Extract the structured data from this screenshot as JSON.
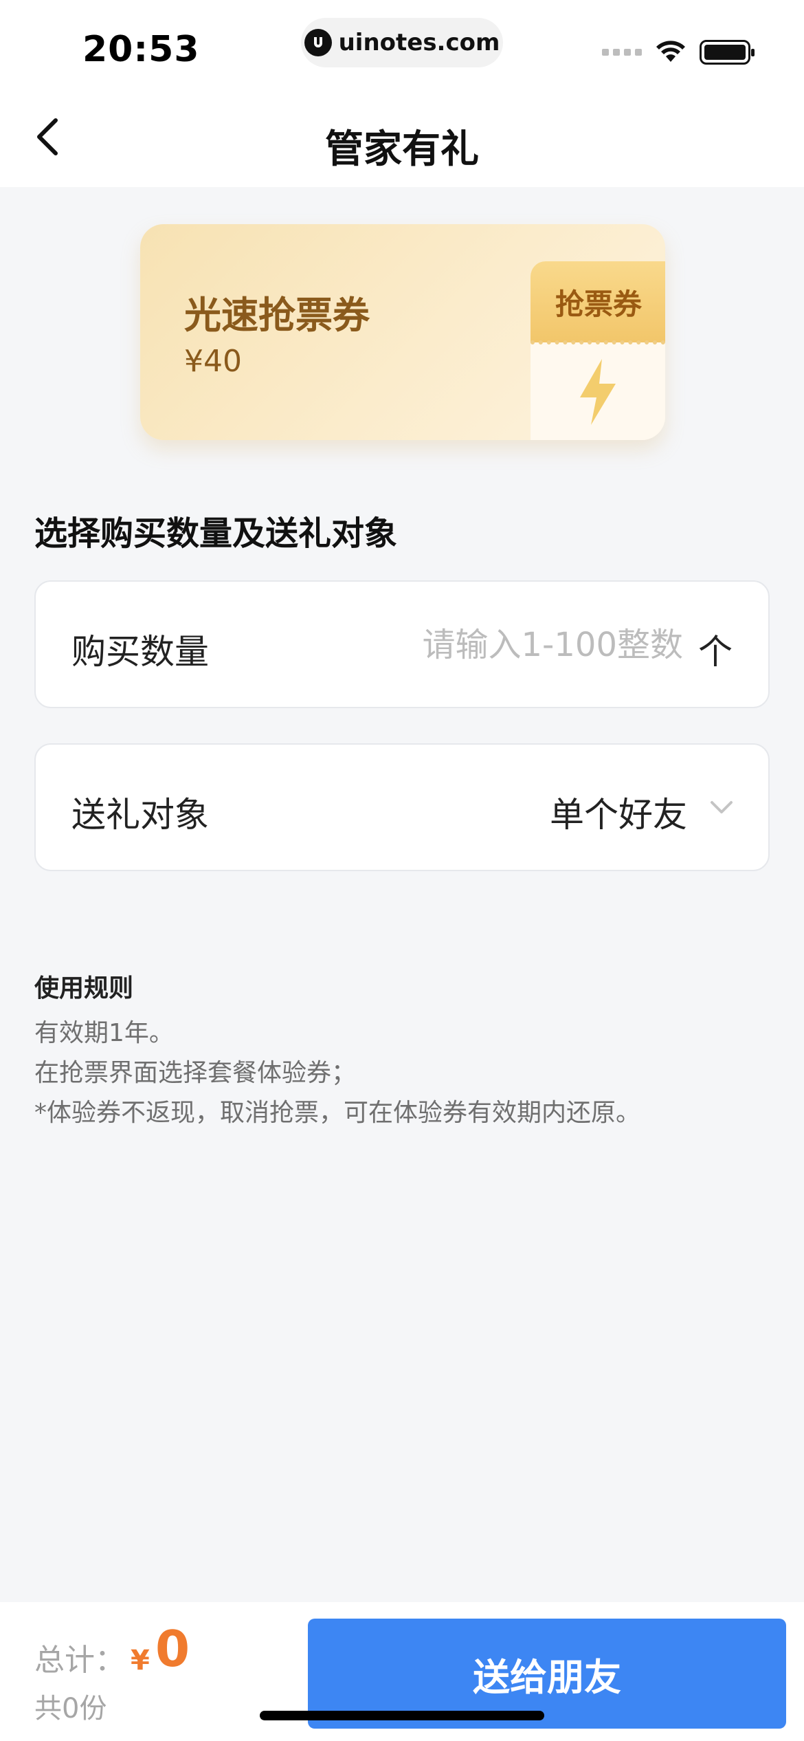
{
  "status_bar": {
    "time": "20:53",
    "url": "uinotes.com"
  },
  "nav": {
    "title": "管家有礼",
    "back_icon": "chevron-left-icon"
  },
  "coupon": {
    "name": "光速抢票券",
    "price": "¥40",
    "tab_label": "抢票券",
    "tab_icon": "lightning-icon"
  },
  "section": {
    "heading": "选择购买数量及送礼对象"
  },
  "form": {
    "quantity": {
      "label": "购买数量",
      "value": "",
      "placeholder": "请输入1-100整数",
      "unit": "个"
    },
    "target": {
      "label": "送礼对象",
      "value": "单个好友",
      "icon": "chevron-down-icon"
    }
  },
  "rules": {
    "title": "使用规则",
    "lines": [
      "有效期1年。",
      "在抢票界面选择套餐体验券；",
      "*体验券不返现，取消抢票，可在体验券有效期内还原。"
    ]
  },
  "footer": {
    "total_label": "总计：",
    "currency": "¥",
    "amount": "0",
    "count": "共0份",
    "submit_label": "送给朋友"
  },
  "colors": {
    "primary": "#3d86f3",
    "accent": "#f07b2e",
    "coupon_text": "#8a5a1c",
    "background": "#f5f6f8"
  }
}
